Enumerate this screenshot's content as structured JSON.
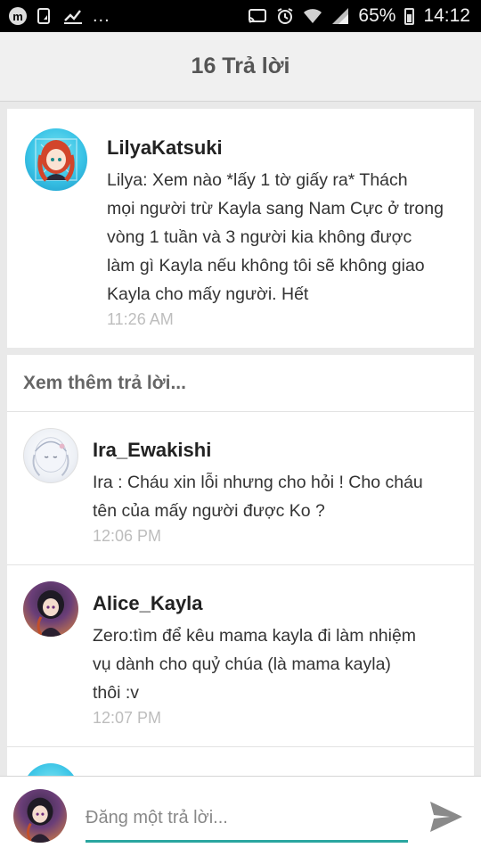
{
  "status_bar": {
    "battery_percent": "65%",
    "time": "14:12",
    "notification_dots": "...",
    "app_badge": "m"
  },
  "header": {
    "title": "16 Trả lời"
  },
  "main_reply": {
    "username": "LilyaKatsuki",
    "lines": [
      "Lilya: Xem nào *lấy 1 tờ giấy ra* Thách",
      "mọi người trừ Kayla sang Nam Cực ở trong",
      "vòng 1 tuần và 3 người kia không được",
      "làm gì Kayla nếu không tôi sẽ không giao",
      "Kayla cho mấy người. Hết"
    ],
    "time": "11:26 AM"
  },
  "more_replies_label": "Xem thêm trả lời...",
  "replies": [
    {
      "username": "Ira_Ewakishi",
      "lines": [
        "Ira : Cháu xin lỗi nhưng cho hỏi ! Cho cháu",
        "tên của mấy người được Ko ?"
      ],
      "time": "12:06 PM"
    },
    {
      "username": "Alice_Kayla",
      "lines": [
        "Zero:tìm để kêu mama kayla đi làm nhiệm",
        "vụ dành cho quỷ chúa (là mama kayla)",
        "thôi :v"
      ],
      "time": "12:07 PM"
    }
  ],
  "composer": {
    "placeholder": "Đăng một trả lời..."
  },
  "colors": {
    "accent": "#2aa6a0",
    "header_bg": "#f0f0f0",
    "page_bg": "#e9e9e9",
    "timestamp": "#bdbdbd"
  },
  "icons": {
    "send": "send-icon",
    "wifi": "wifi-icon",
    "signal": "signal-icon",
    "battery": "battery-icon",
    "alarm": "alarm-icon",
    "cast": "cast-icon"
  }
}
